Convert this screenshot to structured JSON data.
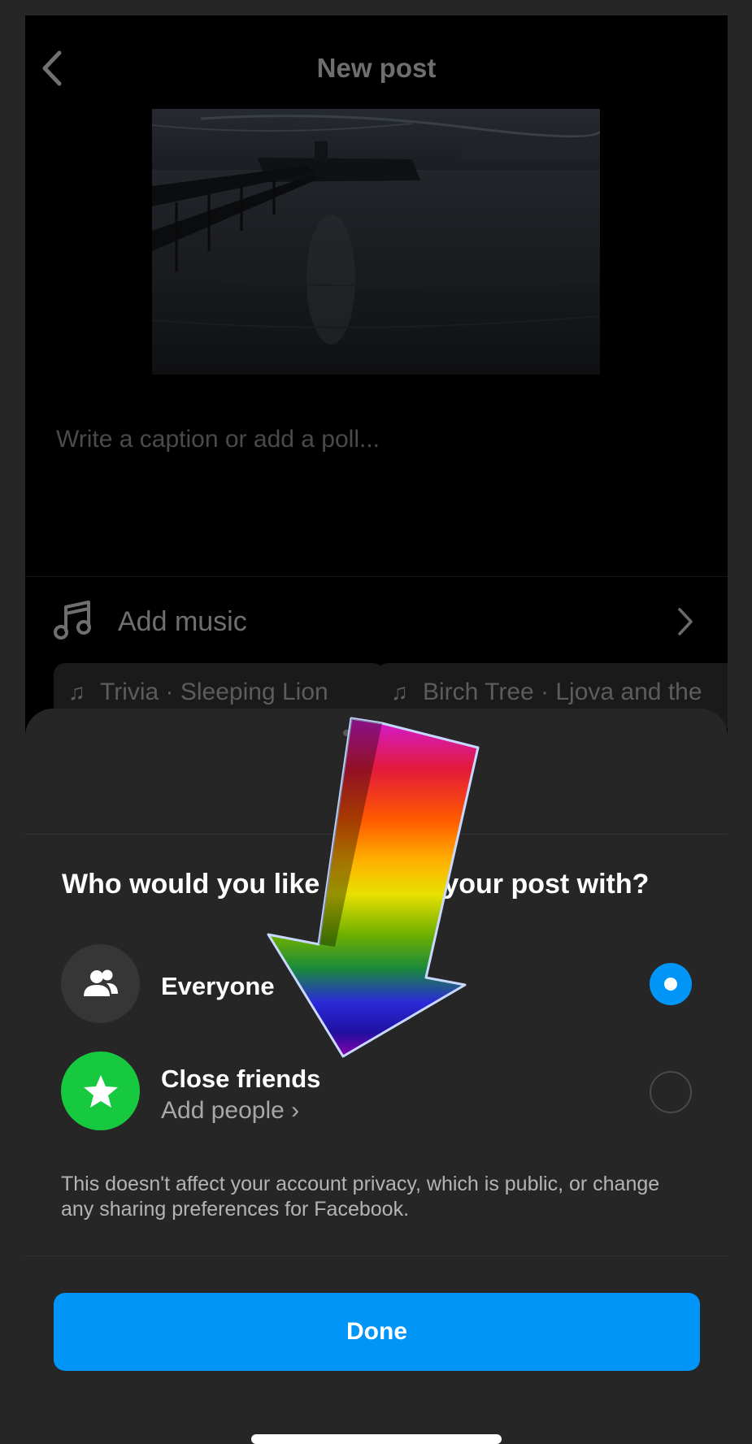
{
  "header": {
    "title": "New post"
  },
  "post": {
    "caption_placeholder": "Write a caption or add a poll..."
  },
  "music": {
    "label": "Add music",
    "suggestions": [
      {
        "title": "Trivia · Sleeping Lion"
      },
      {
        "title": "Birch Tree · Ljova and the"
      }
    ]
  },
  "sheet": {
    "title": "Aud",
    "question_part1": "Who would you like",
    "question_part2": "your post with?",
    "options": [
      {
        "label": "Everyone",
        "selected": true
      },
      {
        "label": "Close friends",
        "sublabel": "Add people ›",
        "selected": false
      }
    ],
    "note": "This doesn't affect your account privacy, which is public, or change any sharing preferences for Facebook.",
    "done_label": "Done"
  },
  "colors": {
    "accent": "#0095f6",
    "close_friends": "#17c93f",
    "sheet_bg": "#262626"
  },
  "icons": [
    "back-chevron-icon",
    "music-note-icon",
    "chevron-right-icon",
    "people-icon",
    "star-icon"
  ]
}
